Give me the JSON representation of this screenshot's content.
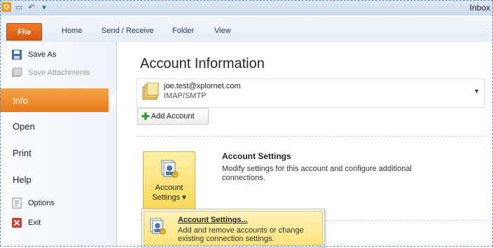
{
  "window": {
    "title": "Inbox"
  },
  "qat": {
    "icons": [
      "outlook-app-icon",
      "save-icon",
      "undo-icon",
      "customize-icon"
    ]
  },
  "ribbon": {
    "tabs": [
      {
        "label": "File"
      },
      {
        "label": "Home"
      },
      {
        "label": "Send / Receive"
      },
      {
        "label": "Folder"
      },
      {
        "label": "View"
      }
    ]
  },
  "nav": {
    "items": [
      {
        "label": "Save As"
      },
      {
        "label": "Save Attachments"
      },
      {
        "label": "Info"
      },
      {
        "label": "Open"
      },
      {
        "label": "Print"
      },
      {
        "label": "Help"
      },
      {
        "label": "Options"
      },
      {
        "label": "Exit"
      }
    ]
  },
  "main": {
    "title": "Account Information",
    "account": {
      "email": "joe.test@xplornet.com",
      "type": "IMAP/SMTP"
    },
    "add_account_label": "Add Account",
    "account_settings": {
      "button_line1": "Account",
      "button_line2": "Settings",
      "heading": "Account Settings",
      "description": "Modify settings for this account and configure additional connections."
    },
    "menu": {
      "title": "Account Settings...",
      "description": "Add and remove accounts or change existing connection settings."
    }
  },
  "colors": {
    "file_tab": "#e06a1c",
    "selected_nav": "#f0902e",
    "highlight": "#fde27a"
  }
}
